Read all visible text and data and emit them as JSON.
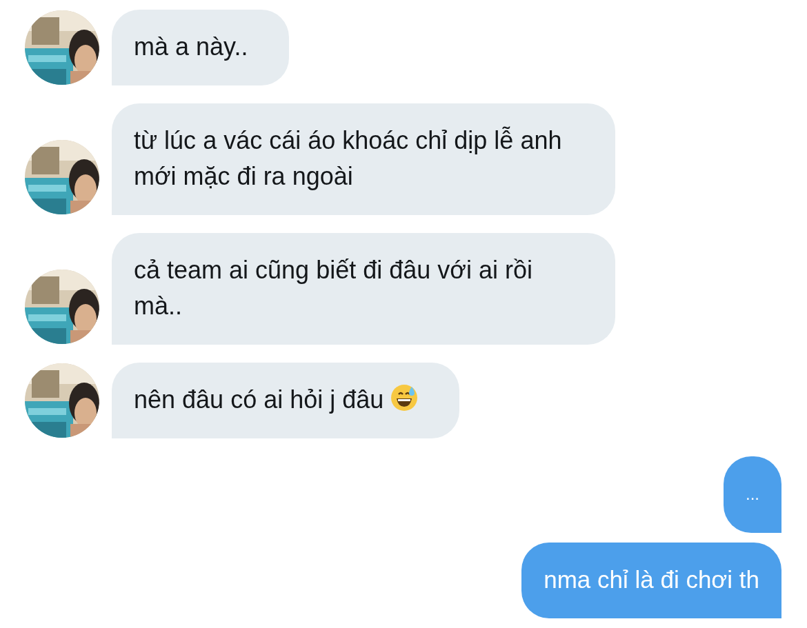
{
  "messages": [
    {
      "kind": "received",
      "text": "mà a này.."
    },
    {
      "kind": "received",
      "text": "từ lúc a vác cái áo khoác chỉ dịp lễ anh mới mặc đi ra ngoài"
    },
    {
      "kind": "received",
      "text": "cả team ai cũng biết đi đâu với ai rồi mà.."
    },
    {
      "kind": "received",
      "text": "nên đâu có ai hỏi j đâu",
      "trailing_emoji": true
    },
    {
      "kind": "sent",
      "text": "..."
    },
    {
      "kind": "sent",
      "text": "nma chỉ là đi chơi th"
    }
  ]
}
